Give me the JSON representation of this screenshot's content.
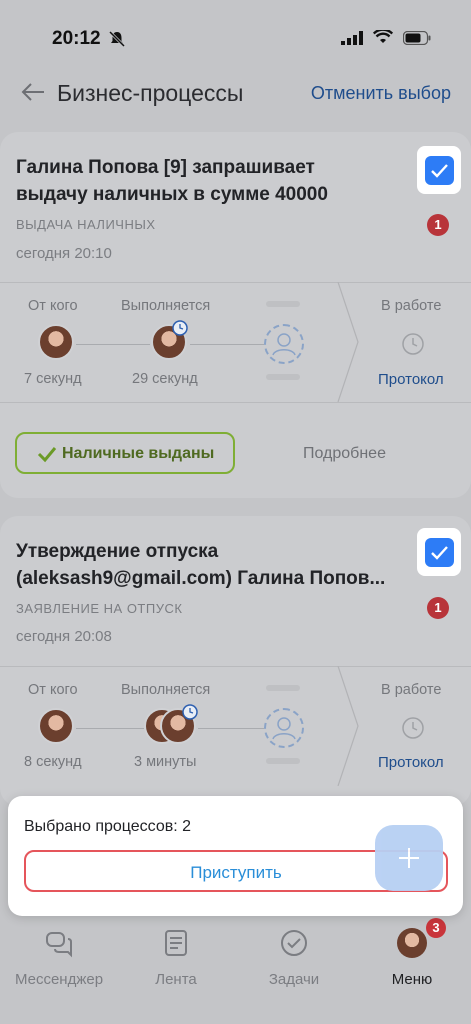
{
  "status_bar": {
    "time": "20:12"
  },
  "header": {
    "title": "Бизнес-процессы",
    "cancel": "Отменить выбор"
  },
  "cards": [
    {
      "title_line1": "Галина Попова [9] запрашивает",
      "title_line2": "выдачу наличных в сумме 40000",
      "type": "ВЫДАЧА НАЛИЧНЫХ",
      "date": "сегодня 20:10",
      "badge": "1",
      "checked": true,
      "from_label": "От кого",
      "from_value": "7 секунд",
      "exec_label": "Выполняется",
      "exec_value": "29 секунд",
      "status_label": "В работе",
      "protocol": "Протокол",
      "action_button": "Наличные выданы",
      "details": "Подробнее"
    },
    {
      "title_line1": "Утверждение отпуска",
      "title_line2": "(aleksash9@gmail.com) Галина Попов...",
      "type": "ЗАЯВЛЕНИЕ НА ОТПУСК",
      "date": "сегодня 20:08",
      "badge": "1",
      "checked": true,
      "from_label": "От кого",
      "from_value": "8 секунд",
      "exec_label": "Выполняется",
      "exec_value": "3 минуты",
      "status_label": "В работе",
      "protocol": "Протокол"
    }
  ],
  "sheet": {
    "selected_text": "Выбрано процессов: 2",
    "start_button": "Приступить"
  },
  "tabbar": {
    "items": [
      {
        "label": "Мессенджер"
      },
      {
        "label": "Лента"
      },
      {
        "label": "Задачи"
      },
      {
        "label": "Меню"
      }
    ],
    "menu_badge": "3"
  },
  "colors": {
    "accent": "#2d7cf6",
    "link": "#1f4d8c",
    "badge": "#c9353b",
    "success": "#7fae35",
    "highlight": "#e5555b"
  }
}
